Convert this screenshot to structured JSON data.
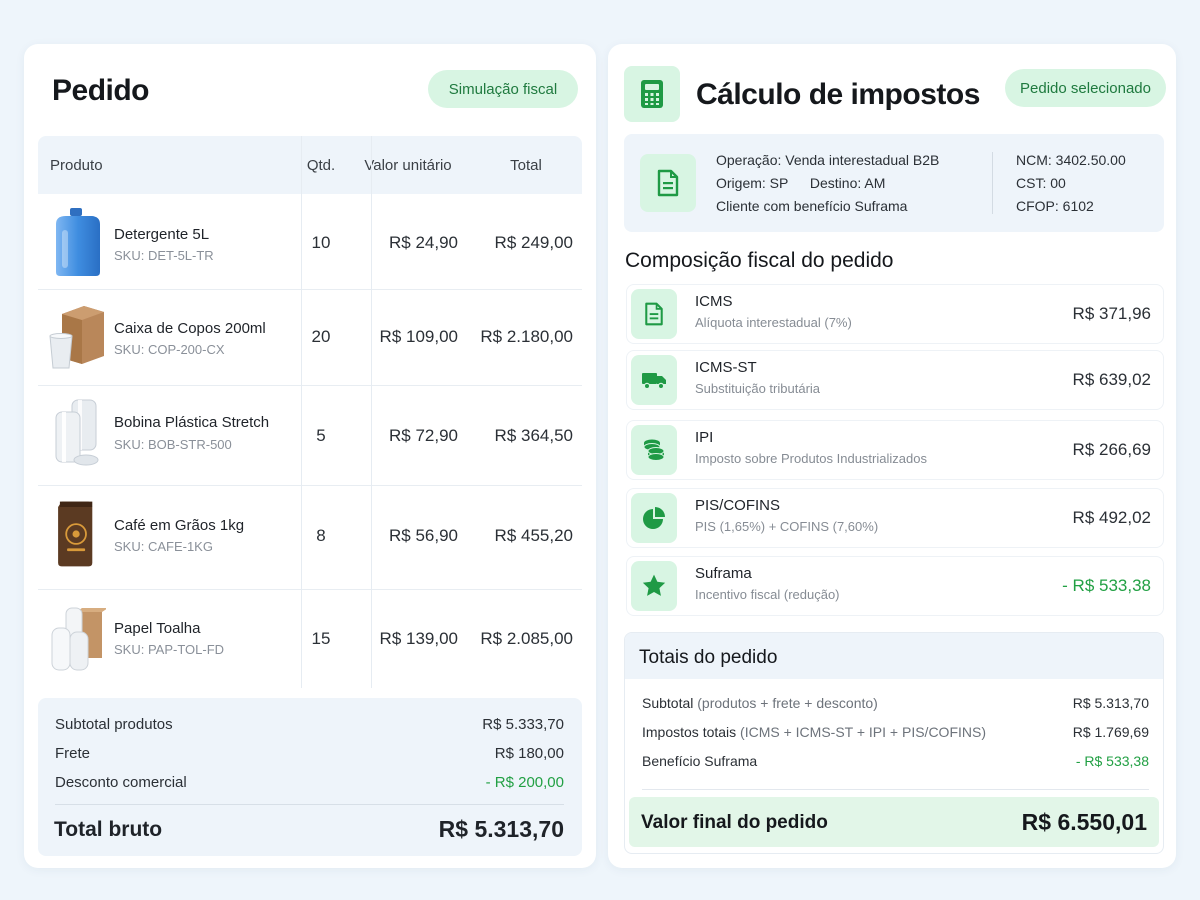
{
  "order": {
    "title": "Pedido",
    "badge": "Simulação fiscal",
    "columns": {
      "product": "Produto",
      "qty": "Qtd.",
      "unit_price": "Valor unitário",
      "total": "Total"
    },
    "items": [
      {
        "name": "Detergente 5L",
        "sku": "SKU: DET-5L-TR",
        "qty": "10",
        "unit": "R$ 24,90",
        "total": "R$ 249,00",
        "image": "detergent-jug"
      },
      {
        "name": "Caixa de Copos 200ml",
        "sku": "SKU: COP-200-CX",
        "qty": "20",
        "unit": "R$ 109,00",
        "total": "R$ 2.180,00",
        "image": "cup-box"
      },
      {
        "name": "Bobina Plástica Stretch",
        "sku": "SKU: BOB-STR-500",
        "qty": "5",
        "unit": "R$ 72,90",
        "total": "R$ 364,50",
        "image": "stretch-rolls"
      },
      {
        "name": "Café em Grãos 1kg",
        "sku": "SKU: CAFE-1KG",
        "qty": "8",
        "unit": "R$ 56,90",
        "total": "R$ 455,20",
        "image": "coffee-bag"
      },
      {
        "name": "Papel Toalha",
        "sku": "SKU: PAP-TOL-FD",
        "qty": "15",
        "unit": "R$ 139,00",
        "total": "R$ 2.085,00",
        "image": "paper-towel"
      }
    ],
    "summary": {
      "subtotal_label": "Subtotal produtos",
      "subtotal_value": "R$ 5.333,70",
      "freight_label": "Frete",
      "freight_value": "R$ 180,00",
      "discount_label": "Desconto comercial",
      "discount_value": "- R$ 200,00",
      "gross_label": "Total bruto",
      "gross_value": "R$ 5.313,70"
    }
  },
  "tax": {
    "title": "Cálculo de impostos",
    "badge": "Pedido selecionado",
    "operation": {
      "line1": "Operação: Venda interestadual B2B",
      "origin": "Origem: SP",
      "destination": "Destino: AM",
      "line3": "Cliente com benefício Suframa",
      "ncm": "NCM: 3402.50.00",
      "cst": "CST:  00",
      "cfop": "CFOP: 6102"
    },
    "composition_title": "Composição fiscal do pedido",
    "items": [
      {
        "name": "ICMS",
        "desc": "Alíquota interestadual (7%)",
        "value": "R$ 371,96",
        "icon": "document-icon"
      },
      {
        "name": "ICMS-ST",
        "desc": "Substituição tributária",
        "value": "R$ 639,02",
        "icon": "truck-icon"
      },
      {
        "name": "IPI",
        "desc": "Imposto sobre Produtos Industrializados",
        "value": "R$ 266,69",
        "icon": "coins-icon"
      },
      {
        "name": "PIS/COFINS",
        "desc": "PIS (1,65%) + COFINS (7,60%)",
        "value": "R$ 492,02",
        "icon": "pie-chart-icon"
      },
      {
        "name": "Suframa",
        "desc": "Incentivo fiscal (redução)",
        "value": "- R$ 533,38",
        "icon": "star-icon"
      }
    ],
    "totals": {
      "title": "Totais do pedido",
      "subtotal_label": "Subtotal",
      "subtotal_note": "(produtos + frete + desconto)",
      "subtotal_value": "R$ 5.313,70",
      "taxes_label": "Impostos totais",
      "taxes_note": "(ICMS + ICMS-ST + IPI + PIS/COFINS)",
      "taxes_value": "R$ 1.769,69",
      "benefit_label": "Benefício Suframa",
      "benefit_value": "- R$ 533,38",
      "final_label": "Valor final do pedido",
      "final_value": "R$ 6.550,01"
    }
  },
  "colors": {
    "accent_green": "#22a044",
    "pill_bg": "#d8f5e3",
    "panel_bg": "#eef4fa"
  }
}
